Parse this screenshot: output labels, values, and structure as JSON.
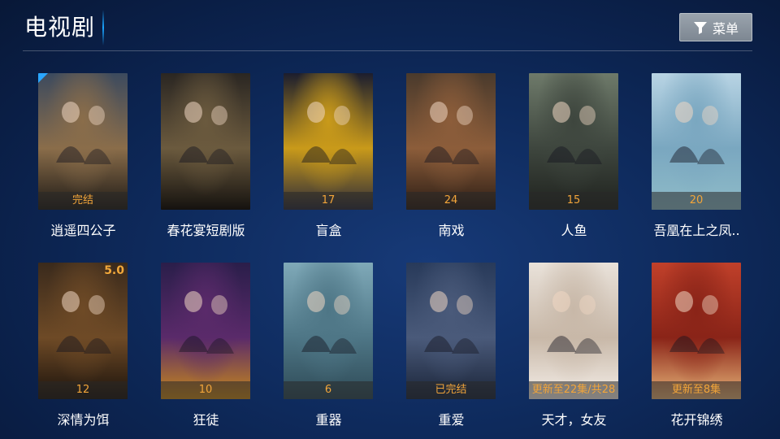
{
  "header": {
    "title": "电视剧",
    "menu_button": {
      "label": "菜单",
      "icon": "filter-icon"
    }
  },
  "rows": [
    [
      {
        "title": "逍遥四公子",
        "badge": "完结",
        "rating": "",
        "poster_text": "",
        "colors": [
          "#3c4a5e",
          "#8a6d4a",
          "#1e1a16"
        ]
      },
      {
        "title": "春花宴短剧版",
        "badge": "",
        "rating": "",
        "poster_text": "",
        "colors": [
          "#2a2622",
          "#6b5a3e",
          "#15120f"
        ]
      },
      {
        "title": "盲盒",
        "badge": "17",
        "rating": "",
        "poster_text": "",
        "colors": [
          "#1b1d2e",
          "#c99a1a",
          "#2a2a3a"
        ]
      },
      {
        "title": "南戏",
        "badge": "24",
        "rating": "",
        "poster_text": "",
        "colors": [
          "#4a3a2c",
          "#8c5d3a",
          "#2a1c14"
        ]
      },
      {
        "title": "人鱼",
        "badge": "15",
        "rating": "",
        "poster_text": "",
        "colors": [
          "#6e7a6a",
          "#3e463e",
          "#1f221e"
        ]
      },
      {
        "title": "吾凰在上之凤..",
        "badge": "20",
        "rating": "",
        "poster_text": "",
        "colors": [
          "#b8d4e4",
          "#7aa7c0",
          "#8fbcc8"
        ]
      }
    ],
    [
      {
        "title": "深情为饵",
        "badge": "12",
        "rating": "5.0",
        "poster_text": "",
        "colors": [
          "#3a2a1c",
          "#6e4a26",
          "#1a120c"
        ]
      },
      {
        "title": "狂徒",
        "badge": "10",
        "rating": "",
        "poster_text": "",
        "colors": [
          "#2a1e4a",
          "#5a2a6a",
          "#c98a1a"
        ]
      },
      {
        "title": "重器",
        "badge": "6",
        "rating": "",
        "poster_text": "",
        "colors": [
          "#7fa9b8",
          "#4e7686",
          "#2e4a56"
        ]
      },
      {
        "title": "重爱",
        "badge": "已完结",
        "rating": "",
        "poster_text": "",
        "colors": [
          "#283a5a",
          "#4a5a7a",
          "#1a2438"
        ]
      },
      {
        "title": "天才，女友",
        "badge": "更新至22集/共28",
        "rating": "",
        "poster_text": "",
        "colors": [
          "#e9e2da",
          "#c8b8a8",
          "#f4eee8"
        ]
      },
      {
        "title": "花开锦绣",
        "badge": "更新至8集",
        "rating": "",
        "poster_text": "",
        "colors": [
          "#c0402a",
          "#8a2418",
          "#e7b478"
        ]
      }
    ]
  ]
}
